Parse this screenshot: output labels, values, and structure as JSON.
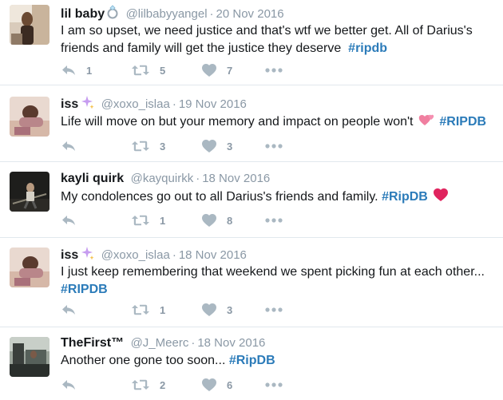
{
  "tweets": [
    {
      "name": "lil baby",
      "handle": "@lilbabyyangel",
      "separator": "·",
      "date": "20 Nov 2016",
      "text_line1": "I am so upset, we need justice and that's wtf we better get. All of Darius's",
      "text_line2": "friends and family will get the justice they deserve",
      "hashtag": "#ripdb",
      "replies": "1",
      "retweets": "5",
      "likes": "7",
      "name_emoji": "ring-icon"
    },
    {
      "name": "iss",
      "handle": "@xoxo_islaa",
      "separator": "·",
      "date": "19 Nov 2016",
      "text": "Life will move on but your memory and impact on people won't",
      "hashtag": "#RIPDB",
      "retweets": "3",
      "likes": "3",
      "name_emoji": "sparkles-icon",
      "text_emoji": "two-hearts-icon"
    },
    {
      "name": "kayli quirk",
      "handle": "@kayquirkk",
      "separator": "·",
      "date": "18 Nov 2016",
      "text": "My condolences go out to all Darius's friends and family.",
      "hashtag": "#RipDB",
      "retweets": "1",
      "likes": "8",
      "text_emoji": "red-heart-icon"
    },
    {
      "name": "iss",
      "handle": "@xoxo_islaa",
      "separator": "·",
      "date": "18 Nov 2016",
      "text": "I just keep remembering that weekend we spent picking fun at each other...",
      "hashtag": "#RIPDB",
      "retweets": "1",
      "likes": "3",
      "name_emoji": "sparkles-icon"
    },
    {
      "name": "TheFirst™",
      "handle": "@J_Meerc",
      "separator": "·",
      "date": "18 Nov 2016",
      "text": "Another one gone too soon...",
      "hashtag": "#RipDB",
      "retweets": "2",
      "likes": "6"
    }
  ],
  "colors": {
    "hashtag": "#2b7bb9",
    "muted": "#8a98a5",
    "divider": "#e1e8ed",
    "text": "#14171a"
  }
}
